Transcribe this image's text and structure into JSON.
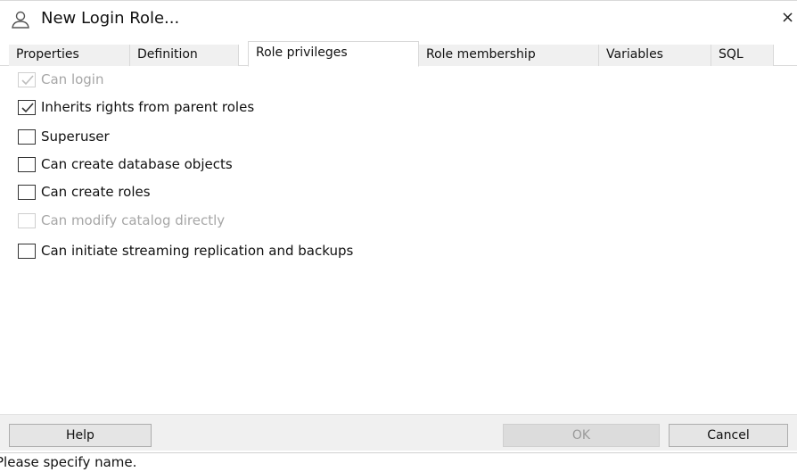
{
  "window": {
    "title": "New Login Role...",
    "close_glyph": "×",
    "icon": "user-role-icon"
  },
  "tabs": [
    {
      "label": "Properties",
      "active": false
    },
    {
      "label": "Definition",
      "active": false
    },
    {
      "label": "Role privileges",
      "active": true
    },
    {
      "label": "Role membership",
      "active": false
    },
    {
      "label": "Variables",
      "active": false
    },
    {
      "label": "SQL",
      "active": false
    }
  ],
  "privileges": [
    {
      "label": "Can login",
      "checked": true,
      "enabled": false
    },
    {
      "label": "Inherits rights from parent roles",
      "checked": true,
      "enabled": true
    },
    {
      "label": "Superuser",
      "checked": false,
      "enabled": true
    },
    {
      "label": "Can create database objects",
      "checked": false,
      "enabled": true
    },
    {
      "label": "Can create roles",
      "checked": false,
      "enabled": true
    },
    {
      "label": "Can modify catalog directly",
      "checked": false,
      "enabled": false
    },
    {
      "label": "Can initiate streaming replication and backups",
      "checked": false,
      "enabled": true
    }
  ],
  "buttons": {
    "help": "Help",
    "ok": "OK",
    "cancel": "Cancel"
  },
  "status": {
    "message": "Please specify name."
  }
}
